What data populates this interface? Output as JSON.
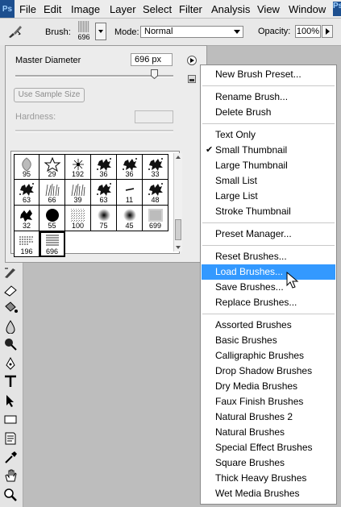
{
  "app": {
    "logo": "Ps",
    "logo_right": "Ps"
  },
  "menubar": {
    "items": [
      "File",
      "Edit",
      "Image",
      "Layer",
      "Select",
      "Filter",
      "Analysis",
      "View",
      "Window"
    ]
  },
  "options": {
    "brush_label": "Brush:",
    "brush_size": "696",
    "mode_label": "Mode:",
    "mode_value": "Normal",
    "opacity_label": "Opacity:",
    "opacity_value": "100%"
  },
  "brush_panel": {
    "master_diameter_label": "Master Diameter",
    "master_diameter_value": "696 px",
    "master_diameter_level": 0.88,
    "sample_size_button": "Use Sample Size",
    "hardness_label": "Hardness:",
    "brushes": [
      {
        "size": "95",
        "shape": "leaf"
      },
      {
        "size": "29",
        "shape": "star"
      },
      {
        "size": "192",
        "shape": "spark"
      },
      {
        "size": "36",
        "shape": "splatter"
      },
      {
        "size": "36",
        "shape": "splatter"
      },
      {
        "size": "33",
        "shape": "splatter"
      },
      {
        "size": "63",
        "shape": "splatter"
      },
      {
        "size": "66",
        "shape": "grass"
      },
      {
        "size": "39",
        "shape": "grass"
      },
      {
        "size": "63",
        "shape": "splatter"
      },
      {
        "size": "11",
        "shape": "stroke"
      },
      {
        "size": "48",
        "shape": "splatter"
      },
      {
        "size": "32",
        "shape": "leafs"
      },
      {
        "size": "55",
        "shape": "hard-round"
      },
      {
        "size": "100",
        "shape": "noise"
      },
      {
        "size": "75",
        "shape": "soft-round"
      },
      {
        "size": "45",
        "shape": "soft-round"
      },
      {
        "size": "699",
        "shape": "texture"
      },
      {
        "size": "196",
        "shape": "text"
      },
      {
        "size": "696",
        "shape": "lines",
        "selected": true
      }
    ]
  },
  "flyout": {
    "group1": [
      "New Brush Preset..."
    ],
    "group2": [
      "Rename Brush...",
      "Delete Brush"
    ],
    "group3": [
      "Text Only",
      "Small Thumbnail",
      "Large Thumbnail",
      "Small List",
      "Large List",
      "Stroke Thumbnail"
    ],
    "checked": "Small Thumbnail",
    "group4": [
      "Preset Manager..."
    ],
    "group5": [
      "Reset Brushes...",
      "Load Brushes...",
      "Save Brushes...",
      "Replace Brushes..."
    ],
    "highlighted": "Load Brushes...",
    "group6": [
      "Assorted Brushes",
      "Basic Brushes",
      "Calligraphic Brushes",
      "Drop Shadow Brushes",
      "Dry Media Brushes",
      "Faux Finish Brushes",
      "Natural Brushes 2",
      "Natural Brushes",
      "Special Effect Brushes",
      "Square Brushes",
      "Thick Heavy Brushes",
      "Wet Media Brushes"
    ]
  },
  "icons": {
    "brush_tool": "paintbrush-icon",
    "panel_menu": "flyout-arrow-icon",
    "cursor": "mouse-pointer-icon"
  }
}
